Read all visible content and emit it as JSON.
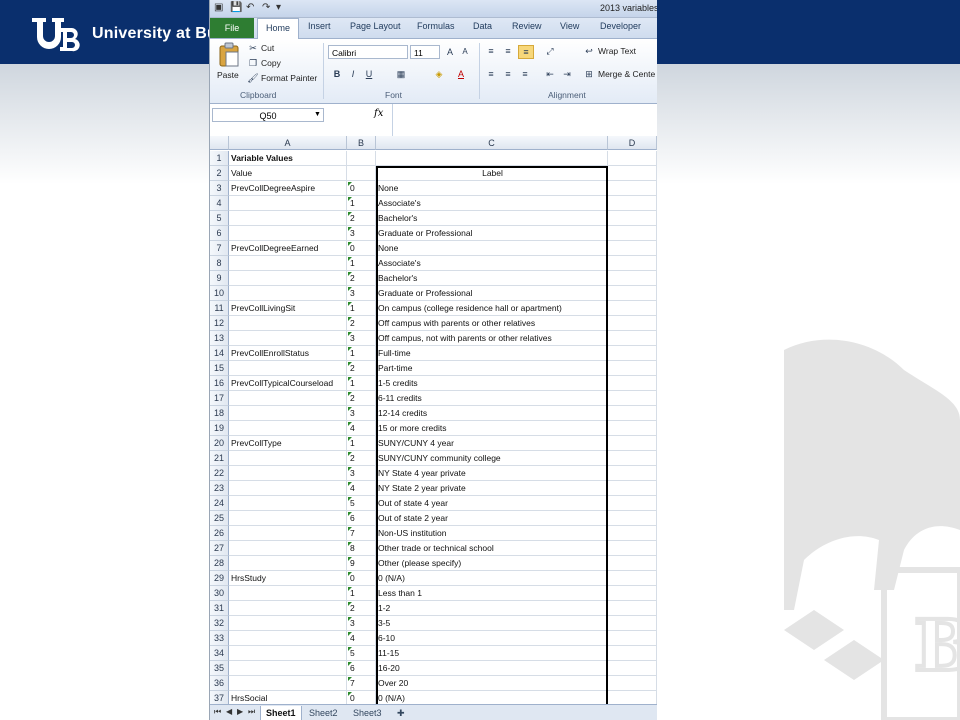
{
  "slide": {
    "logo_text": "University at Bu",
    "colors": {
      "banner": "#0a2f6d",
      "accent_green": "#2e7d32"
    }
  },
  "excel": {
    "title": "2013 variables",
    "ribbon_tabs": [
      "File",
      "Home",
      "Insert",
      "Page Layout",
      "Formulas",
      "Data",
      "Review",
      "View",
      "Developer"
    ],
    "clipboard": {
      "paste": "Paste",
      "cut": "Cut",
      "copy": "Copy",
      "format_painter": "Format Painter",
      "group": "Clipboard"
    },
    "font": {
      "name": "Calibri",
      "size": "11",
      "group": "Font"
    },
    "alignment": {
      "wrap": "Wrap Text",
      "merge": "Merge & Cente",
      "group": "Alignment"
    },
    "name_box": "Q50",
    "fx": "fx",
    "columns": [
      "A",
      "B",
      "C",
      "D"
    ],
    "rows": [
      {
        "n": "1",
        "a": "Variable Values",
        "b": "",
        "c": ""
      },
      {
        "n": "2",
        "a": "Value",
        "b": "",
        "c": "Label"
      },
      {
        "n": "3",
        "a": "PrevCollDegreeAspire",
        "b": "0",
        "c": "None"
      },
      {
        "n": "4",
        "a": "",
        "b": "1",
        "c": "Associate's"
      },
      {
        "n": "5",
        "a": "",
        "b": "2",
        "c": "Bachelor's"
      },
      {
        "n": "6",
        "a": "",
        "b": "3",
        "c": "Graduate or Professional"
      },
      {
        "n": "7",
        "a": "PrevCollDegreeEarned",
        "b": "0",
        "c": "None"
      },
      {
        "n": "8",
        "a": "",
        "b": "1",
        "c": "Associate's"
      },
      {
        "n": "9",
        "a": "",
        "b": "2",
        "c": "Bachelor's"
      },
      {
        "n": "10",
        "a": "",
        "b": "3",
        "c": "Graduate or Professional"
      },
      {
        "n": "11",
        "a": "PrevCollLivingSit",
        "b": "1",
        "c": "On campus (college residence hall or apartment)"
      },
      {
        "n": "12",
        "a": "",
        "b": "2",
        "c": "Off campus with parents or other relatives"
      },
      {
        "n": "13",
        "a": "",
        "b": "3",
        "c": "Off campus, not with parents or other relatives"
      },
      {
        "n": "14",
        "a": "PrevCollEnrollStatus",
        "b": "1",
        "c": "Full-time"
      },
      {
        "n": "15",
        "a": "",
        "b": "2",
        "c": "Part-time"
      },
      {
        "n": "16",
        "a": "PrevCollTypicalCourseload",
        "b": "1",
        "c": "1-5 credits"
      },
      {
        "n": "17",
        "a": "",
        "b": "2",
        "c": "6-11 credits"
      },
      {
        "n": "18",
        "a": "",
        "b": "3",
        "c": "12-14 credits"
      },
      {
        "n": "19",
        "a": "",
        "b": "4",
        "c": "15 or more credits"
      },
      {
        "n": "20",
        "a": "PrevCollType",
        "b": "1",
        "c": "SUNY/CUNY 4 year"
      },
      {
        "n": "21",
        "a": "",
        "b": "2",
        "c": "SUNY/CUNY community college"
      },
      {
        "n": "22",
        "a": "",
        "b": "3",
        "c": "NY State 4 year private"
      },
      {
        "n": "23",
        "a": "",
        "b": "4",
        "c": "NY State 2 year private"
      },
      {
        "n": "24",
        "a": "",
        "b": "5",
        "c": "Out of state 4 year"
      },
      {
        "n": "25",
        "a": "",
        "b": "6",
        "c": "Out of state 2 year"
      },
      {
        "n": "26",
        "a": "",
        "b": "7",
        "c": "Non-US institution"
      },
      {
        "n": "27",
        "a": "",
        "b": "8",
        "c": "Other trade or technical school"
      },
      {
        "n": "28",
        "a": "",
        "b": "9",
        "c": "Other (please specify)"
      },
      {
        "n": "29",
        "a": "HrsStudy",
        "b": "0",
        "c": "0 (N/A)"
      },
      {
        "n": "30",
        "a": "",
        "b": "1",
        "c": "Less than 1"
      },
      {
        "n": "31",
        "a": "",
        "b": "2",
        "c": "1-2"
      },
      {
        "n": "32",
        "a": "",
        "b": "3",
        "c": "3-5"
      },
      {
        "n": "33",
        "a": "",
        "b": "4",
        "c": "6-10"
      },
      {
        "n": "34",
        "a": "",
        "b": "5",
        "c": "11-15"
      },
      {
        "n": "35",
        "a": "",
        "b": "6",
        "c": "16-20"
      },
      {
        "n": "36",
        "a": "",
        "b": "7",
        "c": "Over 20"
      },
      {
        "n": "37",
        "a": "HrsSocial",
        "b": "0",
        "c": "0 (N/A)"
      }
    ],
    "sheets": [
      "Sheet1",
      "Sheet2",
      "Sheet3"
    ]
  }
}
